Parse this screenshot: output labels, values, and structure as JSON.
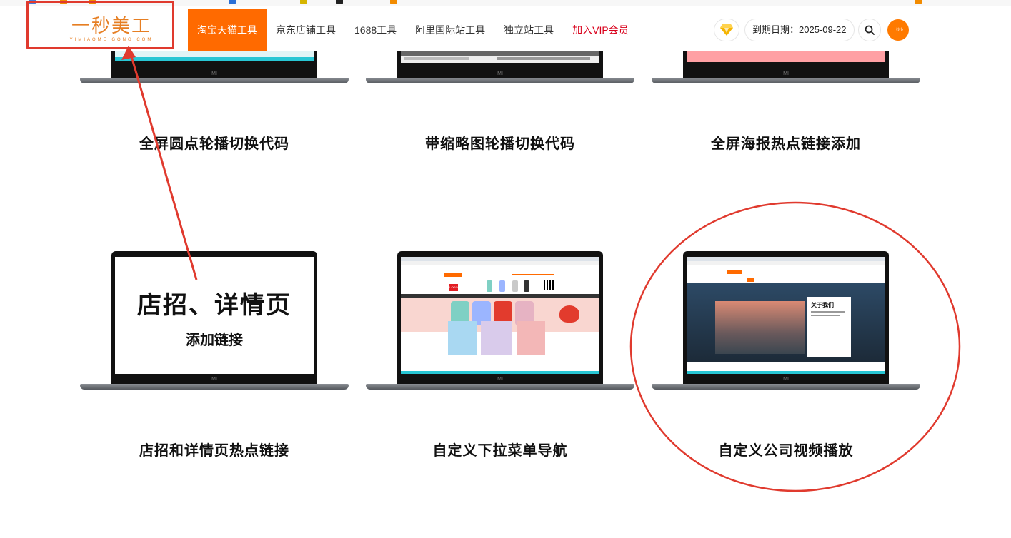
{
  "header": {
    "logo_text": "一秒美工",
    "logo_subtext": "YIMIAOMEIGONG.COM",
    "nav": [
      {
        "label": "淘宝天猫工具",
        "active": true
      },
      {
        "label": "京东店铺工具",
        "active": false
      },
      {
        "label": "1688工具",
        "active": false
      },
      {
        "label": "阿里国际站工具",
        "active": false
      },
      {
        "label": "独立站工具",
        "active": false
      },
      {
        "label": "加入VIP会员",
        "active": false
      }
    ],
    "expiry_label": "到期日期：",
    "expiry_date": "2025-09-22",
    "avatar_text": "一秒小"
  },
  "cards": [
    {
      "title": "全屏圆点轮播切换代码"
    },
    {
      "title": "带缩略图轮播切换代码"
    },
    {
      "title": "全屏海报热点链接添加"
    },
    {
      "title": "店招和详情页热点链接",
      "screen_main": "店招、详情页",
      "screen_sub": "添加链接"
    },
    {
      "title": "自定义下拉菜单导航",
      "screen_logo": "LOGO"
    },
    {
      "title": "自定义公司视频播放",
      "screen_heading": "关于我们"
    }
  ],
  "laptop_brand": "MI",
  "colors": {
    "accent": "#ff6a00",
    "vip": "#d9001b",
    "annotation": "#e03a2e",
    "logo": "#e67e22"
  }
}
